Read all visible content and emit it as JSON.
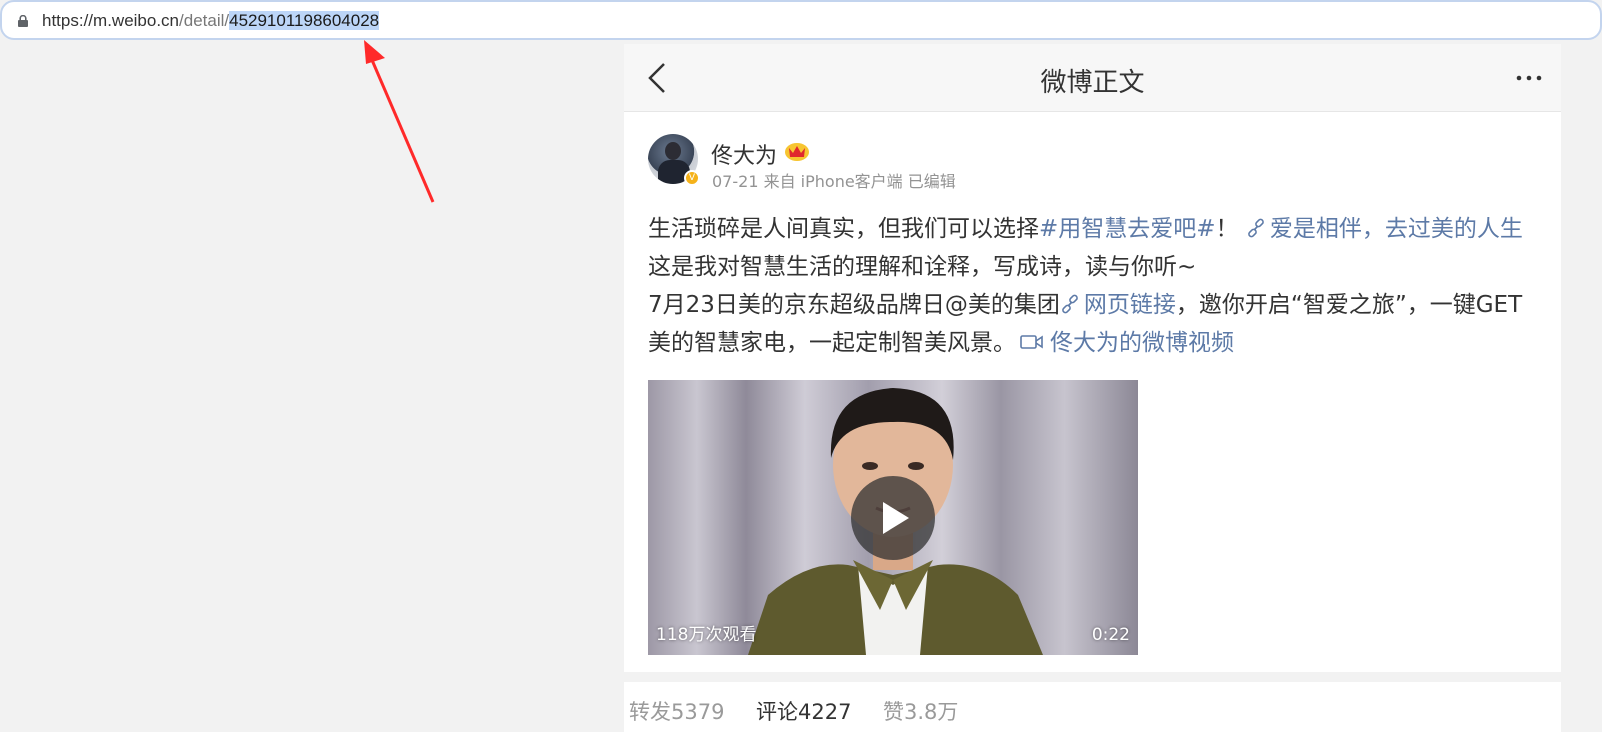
{
  "browser": {
    "url_prefix": "https://",
    "url_host": "m.weibo.cn",
    "url_path": "/detail/",
    "url_selected": "4529101198604028"
  },
  "header": {
    "title": "微博正文",
    "back_icon": "chevron-left-icon",
    "more_icon": "more-dots-icon"
  },
  "post": {
    "author": "佟大为",
    "meta": "07-21 来自 iPhone客户端 已编辑",
    "text": {
      "p1": "生活琐碎是人间真实，但我们可以选择",
      "hashtag": "#用智慧去爱吧#",
      "p2": "！",
      "link1": "爱是相伴，去过美的人生",
      "p3": "这是我对智慧生活的理解和诠释，写成诗，读与你听~",
      "p4": "7月23日美的京东超级品牌日",
      "mention": "@美的集团",
      "link2": "网页链接",
      "p5": "，邀你开启“智爱之旅”，一键GET美的智慧家电，一起定制智美风景。",
      "video_link": "佟大为的微博视频"
    },
    "video": {
      "views": "118万次观看",
      "duration": "0:22"
    }
  },
  "stats": {
    "reposts": "转发5379",
    "comments": "评论4227",
    "likes": "赞3.8万"
  },
  "colors": {
    "link": "#5d7aa7",
    "selection": "#bcd5f7",
    "annotation_arrow": "#ff2a2a",
    "verified": "#f5b21a"
  }
}
